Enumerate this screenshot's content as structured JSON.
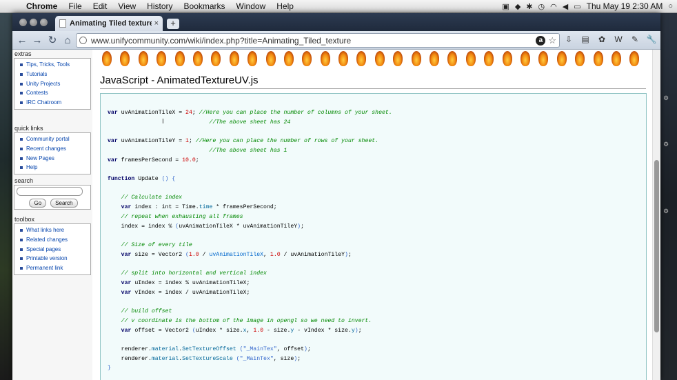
{
  "menubar": {
    "apple": "",
    "app": "Chrome",
    "items": [
      "File",
      "Edit",
      "View",
      "History",
      "Bookmarks",
      "Window",
      "Help"
    ],
    "clock": "Thu May 19  2:30 AM"
  },
  "tab": {
    "title": "Animating Tiled texture – Ur",
    "close": "×"
  },
  "newtab": "+",
  "toolbar": {
    "url": "www.unifycommunity.com/wiki/index.php?title=Animating_Tiled_texture",
    "ext_a": "a"
  },
  "sidebar": {
    "extras": {
      "title": "extras",
      "items": [
        "Tips, Tricks, Tools",
        "Tutorials",
        "Unity Projects",
        "Contests",
        "IRC Chatroom"
      ]
    },
    "quicklinks": {
      "title": "quick links",
      "items": [
        "Community portal",
        "Recent changes",
        "New Pages",
        "Help"
      ]
    },
    "search": {
      "title": "search",
      "go": "Go",
      "search": "Search"
    },
    "toolbox": {
      "title": "toolbox",
      "items": [
        "What links here",
        "Related changes",
        "Special pages",
        "Printable version",
        "Permanent link"
      ]
    }
  },
  "page": {
    "heading": "JavaScript - AnimatedTextureUV.js"
  },
  "code": {
    "lines": [
      [
        [
          "kw",
          "var"
        ],
        [
          "t",
          " uvAnimationTileX = "
        ],
        [
          "num",
          "24"
        ],
        [
          "t",
          "; "
        ],
        [
          "cm",
          "//Here you can place the number of columns of your sheet."
        ]
      ],
      [
        [
          "t",
          "                              "
        ],
        [
          "cm",
          "//The above sheet has 24"
        ]
      ],
      [
        [
          "t",
          ""
        ]
      ],
      [
        [
          "kw",
          "var"
        ],
        [
          "t",
          " uvAnimationTileY = "
        ],
        [
          "num",
          "1"
        ],
        [
          "t",
          "; "
        ],
        [
          "cm",
          "//Here you can place the number of rows of your sheet."
        ]
      ],
      [
        [
          "t",
          "                              "
        ],
        [
          "cm",
          "//The above sheet has 1"
        ]
      ],
      [
        [
          "kw",
          "var"
        ],
        [
          "t",
          " framesPerSecond = "
        ],
        [
          "num",
          "10.0"
        ],
        [
          "t",
          ";"
        ]
      ],
      [
        [
          "t",
          ""
        ]
      ],
      [
        [
          "fn",
          "function"
        ],
        [
          "t",
          " Update "
        ],
        [
          "str",
          "() {"
        ]
      ],
      [
        [
          "t",
          ""
        ]
      ],
      [
        [
          "t",
          "    "
        ],
        [
          "cm",
          "// Calculate index"
        ]
      ],
      [
        [
          "t",
          "    "
        ],
        [
          "kw",
          "var"
        ],
        [
          "t",
          " index : int = Time."
        ],
        [
          "mem",
          "time"
        ],
        [
          "t",
          " * framesPerSecond;"
        ]
      ],
      [
        [
          "t",
          "    "
        ],
        [
          "cm",
          "// repeat when exhausting all frames"
        ]
      ],
      [
        [
          "t",
          "    index = index % "
        ],
        [
          "str",
          "("
        ],
        [
          "t",
          "uvAnimationTileX * uvAnimationTileY"
        ],
        [
          "str",
          ")"
        ],
        [
          "t",
          ";"
        ]
      ],
      [
        [
          "t",
          ""
        ]
      ],
      [
        [
          "t",
          "    "
        ],
        [
          "cm",
          "// Size of every tile"
        ]
      ],
      [
        [
          "t",
          "    "
        ],
        [
          "kw",
          "var"
        ],
        [
          "t",
          " size = Vector2 "
        ],
        [
          "str",
          "("
        ],
        [
          "num",
          "1.0"
        ],
        [
          "t",
          " / "
        ],
        [
          "vr",
          "uvAnimationTileX"
        ],
        [
          "t",
          ", "
        ],
        [
          "num",
          "1.0"
        ],
        [
          "t",
          " / uvAnimationTileY"
        ],
        [
          "str",
          ")"
        ],
        [
          "t",
          ";"
        ]
      ],
      [
        [
          "t",
          ""
        ]
      ],
      [
        [
          "t",
          "    "
        ],
        [
          "cm",
          "// split into horizontal and vertical index"
        ]
      ],
      [
        [
          "t",
          "    "
        ],
        [
          "kw",
          "var"
        ],
        [
          "t",
          " uIndex = index % uvAnimationTileX;"
        ]
      ],
      [
        [
          "t",
          "    "
        ],
        [
          "kw",
          "var"
        ],
        [
          "t",
          " vIndex = index / uvAnimationTileX;"
        ]
      ],
      [
        [
          "t",
          ""
        ]
      ],
      [
        [
          "t",
          "    "
        ],
        [
          "cm",
          "// build offset"
        ]
      ],
      [
        [
          "t",
          "    "
        ],
        [
          "cm",
          "// v coordinate is the bottom of the image in opengl so we need to invert."
        ]
      ],
      [
        [
          "t",
          "    "
        ],
        [
          "kw",
          "var"
        ],
        [
          "t",
          " offset = Vector2 "
        ],
        [
          "str",
          "("
        ],
        [
          "t",
          "uIndex * size."
        ],
        [
          "mem",
          "x"
        ],
        [
          "t",
          ", "
        ],
        [
          "num",
          "1.0"
        ],
        [
          "t",
          " - size."
        ],
        [
          "mem",
          "y"
        ],
        [
          "t",
          " - vIndex * size."
        ],
        [
          "mem",
          "y"
        ],
        [
          "str",
          ")"
        ],
        [
          "t",
          ";"
        ]
      ],
      [
        [
          "t",
          ""
        ]
      ],
      [
        [
          "t",
          "    renderer."
        ],
        [
          "mem",
          "material"
        ],
        [
          "t",
          "."
        ],
        [
          "mem",
          "SetTextureOffset"
        ],
        [
          "t",
          " "
        ],
        [
          "str",
          "(\"_MainTex\""
        ],
        [
          "t",
          ", offset"
        ],
        [
          "str",
          ")"
        ],
        [
          "t",
          ";"
        ]
      ],
      [
        [
          "t",
          "    renderer."
        ],
        [
          "mem",
          "material"
        ],
        [
          "t",
          "."
        ],
        [
          "mem",
          "SetTextureScale"
        ],
        [
          "t",
          " "
        ],
        [
          "str",
          "(\"_MainTex\""
        ],
        [
          "t",
          ", size"
        ],
        [
          "str",
          ")"
        ],
        [
          "t",
          ";"
        ]
      ],
      [
        [
          "str",
          "}"
        ]
      ]
    ]
  }
}
